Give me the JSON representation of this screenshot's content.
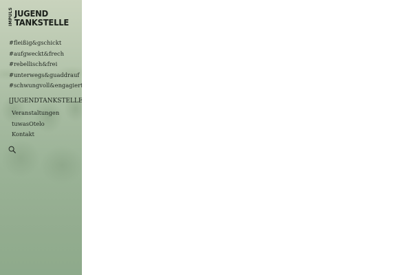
{
  "logo": {
    "small": "IMPULS",
    "line1": "JUGEND",
    "line2": "TANKSTELLE"
  },
  "hashtags": [
    "#fleißig&gschickt",
    "#aufgweckt&frech",
    "#rebellisch&frei",
    "#unterwegs&guaddrauf",
    "#schwungvoll&engagiert"
  ],
  "section": {
    "title": "[JUGENDTANKSTELLE]",
    "items": [
      "Veranstaltungen",
      "tuwasOtelo",
      "Kontakt"
    ]
  },
  "icons": {
    "search": "search-icon"
  },
  "colors": {
    "sidebar_top": "#c9d3bd",
    "sidebar_bottom": "#8eaa8b",
    "text": "#1f2520"
  }
}
